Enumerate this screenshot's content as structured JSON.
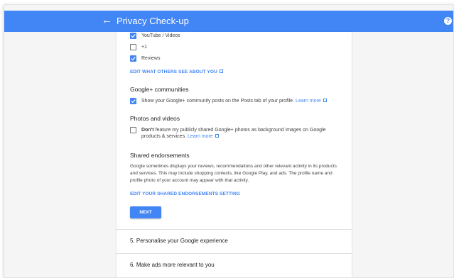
{
  "topbar": {
    "back_icon": "←",
    "title": "Privacy Check-up",
    "help_icon": "?"
  },
  "shared_sections": {
    "items": [
      {
        "label": "YouTube / Videos",
        "checked": true
      },
      {
        "label": "+1",
        "checked": false
      },
      {
        "label": "Reviews",
        "checked": true
      }
    ],
    "edit_link": "EDIT WHAT OTHERS SEE ABOUT YOU"
  },
  "communities": {
    "heading": "Google+ communities",
    "text": "Show your Google+ community posts on the Posts tab of your profile.",
    "learn_more": "Learn more",
    "checked": true
  },
  "photos": {
    "heading": "Photos and videos",
    "bold": "Don't",
    "text": "feature my publicly shared Google+ photos as background images on Google products & services.",
    "learn_more": "Learn more",
    "checked": false
  },
  "endorsements": {
    "heading": "Shared endorsements",
    "paragraph": "Google sometimes displays your reviews, recommendations and other relevant activity in its products and services. This may include shopping contexts, like Google Play, and ads. The profile name and profile photo of your account may appear with that activity.",
    "edit_link": "EDIT YOUR SHARED ENDORSEMENTS SETTING"
  },
  "next_button": "NEXT",
  "steps": [
    "5. Personalise your Google experience",
    "6. Make ads more relevant to you"
  ]
}
